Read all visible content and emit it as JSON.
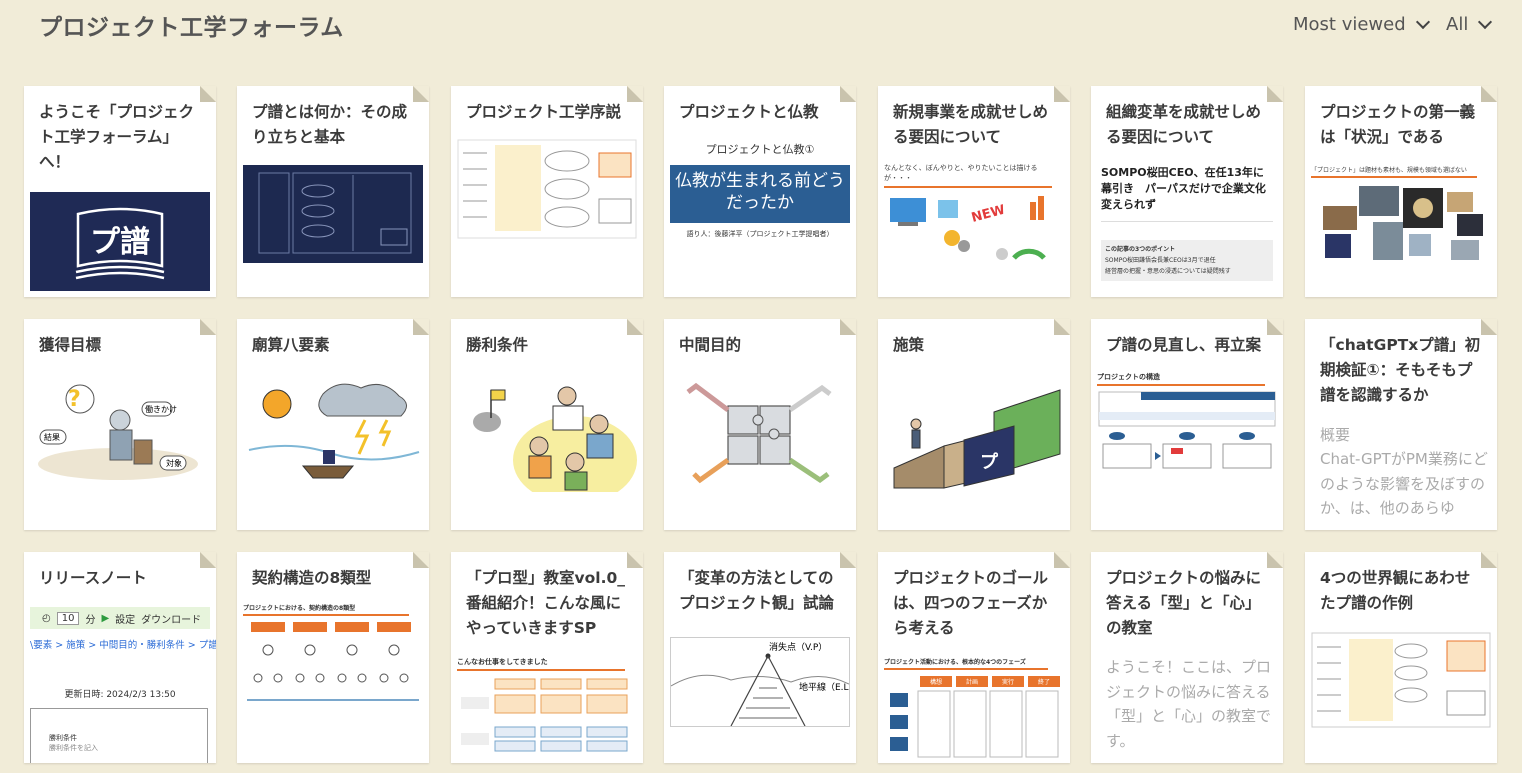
{
  "header": {
    "title": "プロジェクト工学フォーラム",
    "sort_label": "Most viewed",
    "filter_label": "All"
  },
  "cards": [
    {
      "title": "ようこそ「プロジェクト工学フォーラム」へ！",
      "thumb_text": "プ譜"
    },
    {
      "title": "プ譜とは何か：その成り立ちと基本"
    },
    {
      "title": "プロジェクト工学序説"
    },
    {
      "title": "プロジェクトと仏教",
      "thumb_heading": "プロジェクトと仏教①",
      "thumb_main": "仏教が生まれる前どうだったか",
      "thumb_sub": "語り人：後藤洋平（プロジェクト工学提唱者）"
    },
    {
      "title": "新規事業を成就せしめる要因について",
      "thumb_caption": "なんとなく、ぼんやりと、やりたいことは描けるが・・・"
    },
    {
      "title": "組織変革を成就せしめる要因について",
      "thumb_headline": "SOMPO桜田CEO、在任13年に幕引き　パーパスだけで企業文化変えられず",
      "thumb_box_title": "この記事の3つのポイント",
      "thumb_point1": "SOMPO桜田謙悟会長兼CEOは3月で退任",
      "thumb_point2": "経営層の把握・意思の浸透については疑問残す"
    },
    {
      "title": "プロジェクトの第一義は「状況」である",
      "thumb_caption": "「プロジェクト」は題材も素材も、規模も領域も選ばない"
    },
    {
      "title": "獲得目標",
      "thumb_label1": "結果",
      "thumb_label2": "働きかけ",
      "thumb_label3": "対象"
    },
    {
      "title": "廟算八要素"
    },
    {
      "title": "勝利条件"
    },
    {
      "title": "中間目的"
    },
    {
      "title": "施策",
      "thumb_text": "プ"
    },
    {
      "title": "プ譜の見直し、再立案",
      "thumb_caption": "プロジェクトの構造"
    },
    {
      "title": "「chatGPTxプ譜」初期検証①：そもそもプ譜を認識するか",
      "desc_heading": "概要",
      "desc": "Chat-GPTがPM業務にどのような影響を及ぼすのか、は、他のあらゆ"
    },
    {
      "title": "リリースノート",
      "thumb_counter": "10",
      "thumb_unit": "分",
      "thumb_settings": "設定",
      "thumb_download": "ダウンロード",
      "thumb_breadcrumb": "\\要素 > 施策 > 中間目的・勝利条件 > プ譜",
      "thumb_updated": "更新日時: 2024/2/3 13:50",
      "thumb_box_title": "勝利条件",
      "thumb_box_sub": "勝利条件を記入"
    },
    {
      "title": "契約構造の8類型",
      "thumb_caption": "プロジェクトにおける、契約構造の8類型"
    },
    {
      "title": "「プロ型」教室vol.0_番組紹介！こんな風にやっていきますSP",
      "thumb_caption": "こんなお仕事をしてきました"
    },
    {
      "title": "「変革の方法としてのプロジェクト観」試論",
      "thumb_label1": "消失点（V.P）",
      "thumb_label2": "地平線（E.L）"
    },
    {
      "title": "プロジェクトのゴールは、四つのフェーズから考える",
      "thumb_caption": "プロジェクト活動における、根本的な4つのフェーズ",
      "phases": [
        "構想",
        "計画",
        "実行",
        "終了"
      ]
    },
    {
      "title": "プロジェクトの悩みに答える「型」と「心」の教室",
      "desc": "ようこそ！ここは、プロジェクトの悩みに答える「型」と「心」の教室です。"
    },
    {
      "title": "4つの世界観にあわせたプ譜の作例"
    }
  ],
  "colors": {
    "background": "#f1ecd8",
    "navy": "#1f2a55",
    "orange": "#e8742c"
  }
}
